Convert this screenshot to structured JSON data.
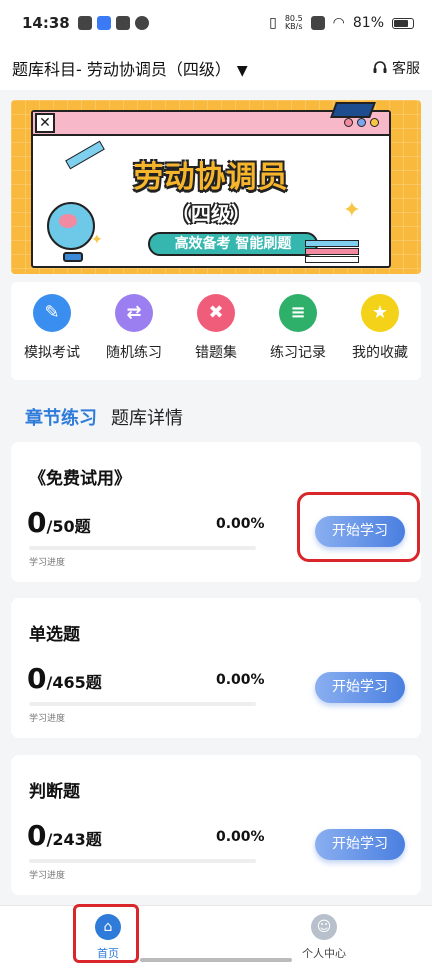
{
  "status_bar": {
    "time": "14:38",
    "net_speed_value": "80.5",
    "net_speed_unit": "KB/s",
    "battery": "81%"
  },
  "header": {
    "subject_label": "题库科目- 劳动协调员（四级）",
    "caret": "▼",
    "service_label": "客服",
    "service_icon": "headset-icon"
  },
  "banner": {
    "title": "劳动协调员",
    "level": "（四级）",
    "slogan": "高效备考 智能刷题"
  },
  "quick_actions": [
    {
      "label": "模拟考试",
      "icon": "exam-icon",
      "color": "#3a8ef0",
      "glyph": "✎"
    },
    {
      "label": "随机练习",
      "icon": "shuffle-icon",
      "color": "#9b7ff0",
      "glyph": "⇄"
    },
    {
      "label": "错题集",
      "icon": "wrong-book-icon",
      "color": "#ef5d7a",
      "glyph": "✖"
    },
    {
      "label": "练习记录",
      "icon": "record-icon",
      "color": "#2fb06a",
      "glyph": "≡"
    },
    {
      "label": "我的收藏",
      "icon": "star-icon",
      "color": "#f4d21a",
      "glyph": "★"
    }
  ],
  "tabs": [
    {
      "label": "章节练习",
      "active": true
    },
    {
      "label": "题库详情",
      "active": false
    }
  ],
  "sections": [
    {
      "title": "《免费试用》",
      "done": "0",
      "total": "/50题",
      "percent": "0.00%",
      "progress": 0,
      "progress_label": "学习进度",
      "button": "开始学习"
    },
    {
      "title": "单选题",
      "done": "0",
      "total": "/465题",
      "percent": "0.00%",
      "progress": 0,
      "progress_label": "学习进度",
      "button": "开始学习"
    },
    {
      "title": "判断题",
      "done": "0",
      "total": "/243题",
      "percent": "0.00%",
      "progress": 0,
      "progress_label": "学习进度",
      "button": "开始学习"
    }
  ],
  "bottom_nav": [
    {
      "label": "首页",
      "icon": "home-icon",
      "active": true,
      "color": "#2e7bd9"
    },
    {
      "label": "个人中心",
      "icon": "profile-icon",
      "active": false,
      "color": "#b8c0cc"
    }
  ],
  "colors": {
    "accent": "#2e7bd9",
    "highlight": "#d8262a"
  }
}
